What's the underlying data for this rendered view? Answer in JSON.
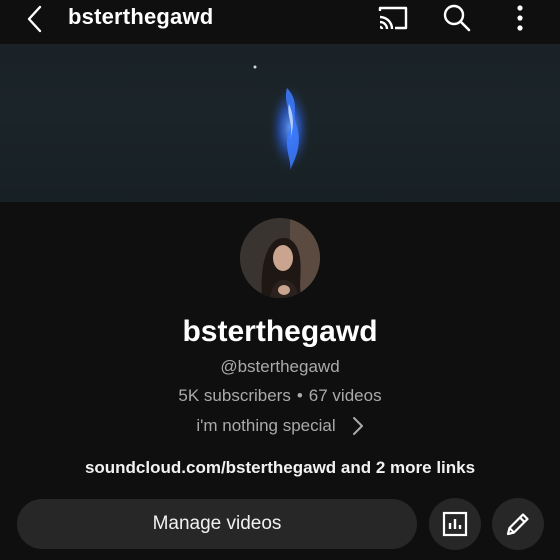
{
  "header": {
    "title": "bsterthegawd",
    "icons": {
      "back": "back-arrow-icon",
      "cast": "cast-icon",
      "search": "search-icon",
      "more": "more-vert-icon"
    }
  },
  "channel": {
    "name": "bsterthegawd",
    "handle": "@bsterthegawd",
    "subscribers": "5K subscribers",
    "separator": "•",
    "videos": "67 videos",
    "description": "i'm nothing special",
    "links": "soundcloud.com/bsterthegawd and 2 more links"
  },
  "actions": {
    "manage_videos": "Manage videos",
    "analytics_icon": "analytics-icon",
    "edit_icon": "pencil-icon"
  },
  "colors": {
    "background": "#0f0f0f",
    "text_primary": "#f1f1f1",
    "text_secondary": "#aaaaaa",
    "button_bg": "#272727",
    "banner_accent": "#2f6bff"
  }
}
